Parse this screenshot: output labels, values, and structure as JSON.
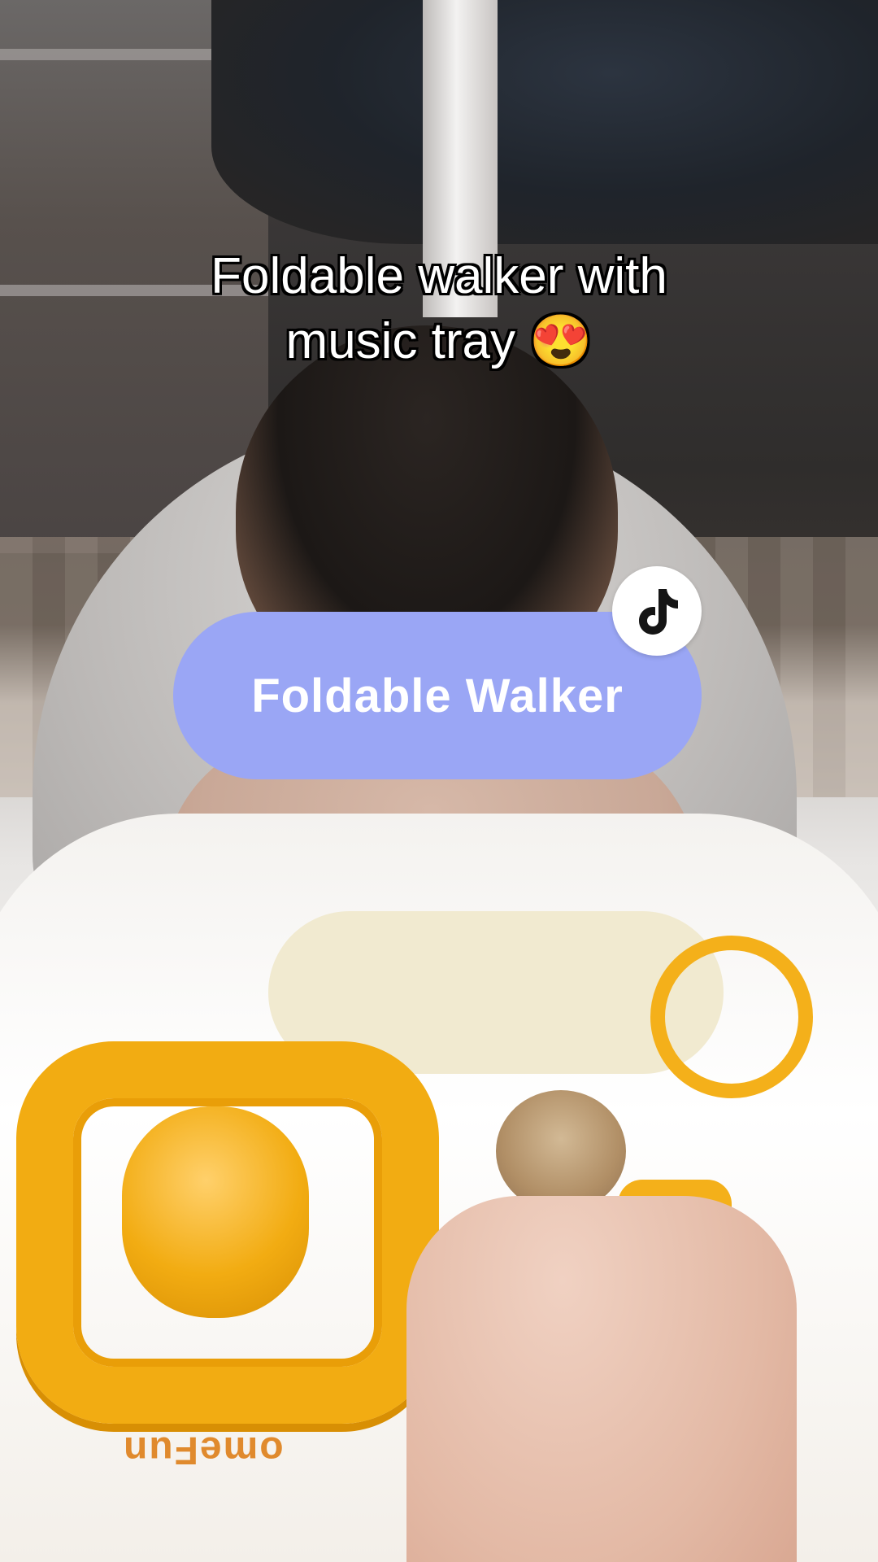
{
  "caption": {
    "line1": "Foldable walker with",
    "line2": "music tray 😍"
  },
  "sticker": {
    "label": "Foldable Walker",
    "color": "#9aa6f5",
    "badge_icon": "tiktok-logo-icon"
  },
  "video": {
    "brand_text_on_toy": "omeFun"
  }
}
